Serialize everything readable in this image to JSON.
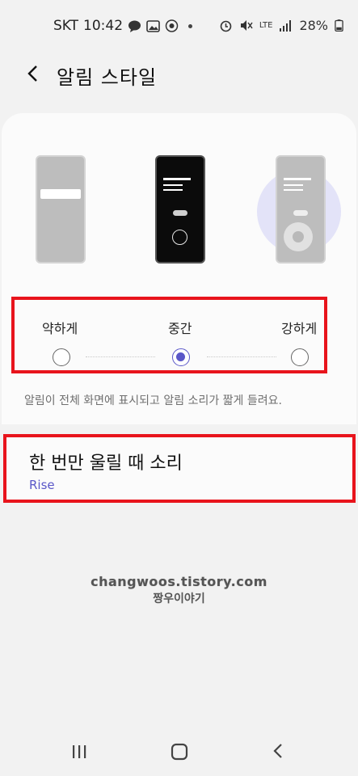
{
  "status_bar": {
    "carrier": "SKT",
    "time": "10:42",
    "network": "LTE",
    "battery": "28%"
  },
  "header": {
    "title": "알림 스타일"
  },
  "intensity": {
    "options": [
      "약하게",
      "중간",
      "강하게"
    ],
    "selected": "중간",
    "description": "알림이 전체 화면에 표시되고 알림 소리가 짧게 들려요."
  },
  "sound": {
    "title": "한 번만 울릴 때 소리",
    "value": "Rise"
  },
  "watermark": {
    "line1": "changwoos.tistory.com",
    "line2": "짱우이야기"
  },
  "colors": {
    "accent": "#5a57c8",
    "highlight_box": "#e8141c"
  }
}
